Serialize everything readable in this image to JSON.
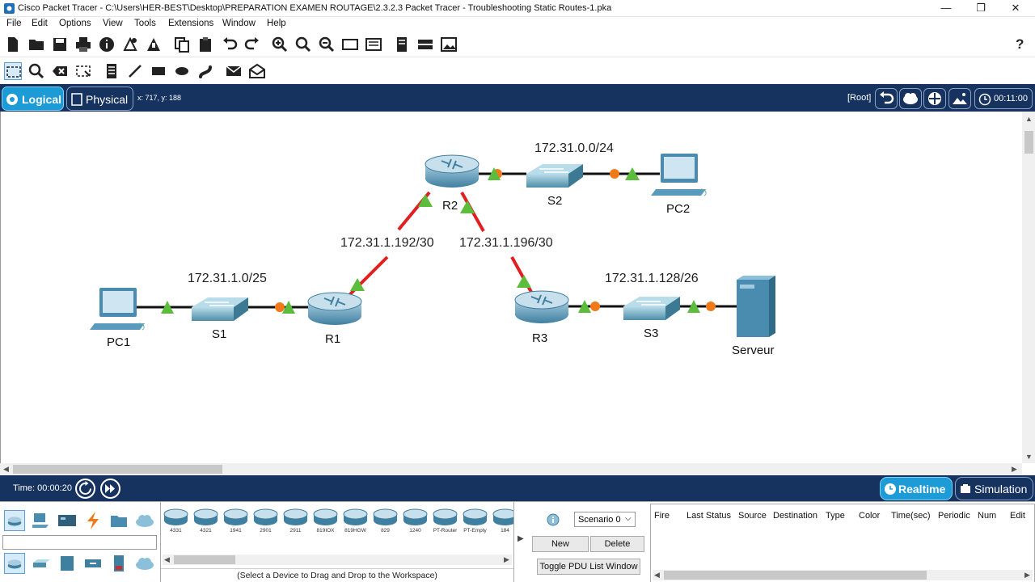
{
  "window": {
    "title": "Cisco Packet Tracer - C:\\Users\\HER-BEST\\Desktop\\PREPARATION EXAMEN ROUTAGE\\2.3.2.3 Packet Tracer - Troubleshooting Static Routes-1.pka",
    "minimize": "—",
    "restore": "❐",
    "close": "✕"
  },
  "menu": [
    "File",
    "Edit",
    "Options",
    "View",
    "Tools",
    "Extensions",
    "Window",
    "Help"
  ],
  "toolbar": {
    "main": [
      "new-file-icon",
      "open-folder-icon",
      "save-icon",
      "print-icon",
      "info-icon",
      "network-wizard-icon",
      "activity-wizard-icon",
      "copy-icon",
      "paste-icon",
      "undo-icon",
      "redo-icon",
      "zoom-in-icon",
      "zoom-reset-icon",
      "zoom-out-icon",
      "drawing-palette-icon",
      "custom-device-icon",
      "viewport-icon",
      "cluster-icon",
      "screenshot-icon"
    ],
    "help": "?",
    "tools": [
      "select-icon",
      "inspect-icon",
      "delete-icon",
      "resize-icon",
      "note-icon",
      "line-icon",
      "rectangle-icon",
      "ellipse-icon",
      "freeform-icon",
      "simple-pdu-icon",
      "complex-pdu-icon"
    ]
  },
  "modes": {
    "logical": "Logical",
    "physical": "Physical",
    "coords": "x: 717, y: 188",
    "root": "[Root]",
    "clock": "00:11:00"
  },
  "topology": {
    "networks": {
      "r2_s2": "172.31.0.0/24",
      "r1_r2": "172.31.1.192/30",
      "r2_r3": "172.31.1.196/30",
      "s1_net": "172.31.1.0/25",
      "s3_net": "172.31.1.128/26"
    },
    "devices": {
      "pc1": "PC1",
      "s1": "S1",
      "r1": "R1",
      "r2": "R2",
      "s2": "S2",
      "pc2": "PC2",
      "r3": "R3",
      "s3": "S3",
      "server": "Serveur"
    },
    "colors": {
      "link_up": "#33aa33",
      "link_down": "#e02020",
      "port_orange": "#f07a1a",
      "cable": "#111111"
    }
  },
  "timebar": {
    "time": "Time: 00:00:20",
    "realtime": "Realtime",
    "simulation": "Simulation"
  },
  "device_palette": {
    "models": [
      "4331",
      "4321",
      "1941",
      "2901",
      "2911",
      "819IOX",
      "819HGW",
      "829",
      "1240",
      "PT-Router",
      "PT-Empty",
      "184"
    ],
    "hint": "(Select a Device to Drag and Drop to the Workspace)"
  },
  "scenario": {
    "selected": "Scenario 0",
    "new": "New",
    "delete": "Delete",
    "toggle": "Toggle PDU List Window"
  },
  "pdu_list": {
    "columns": [
      "Fire",
      "Last Status",
      "Source",
      "Destination",
      "Type",
      "Color",
      "Time(sec)",
      "Periodic",
      "Num",
      "Edit"
    ]
  }
}
